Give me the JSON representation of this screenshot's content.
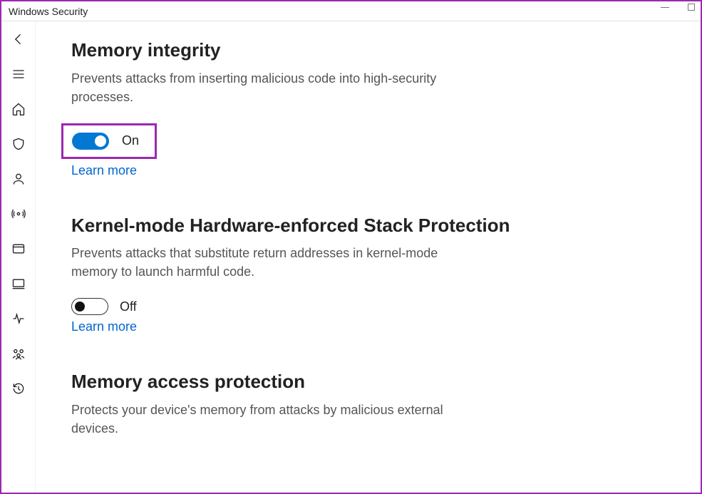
{
  "window": {
    "title": "Windows Security"
  },
  "sections": {
    "memory_integrity": {
      "heading": "Memory integrity",
      "desc": "Prevents attacks from inserting malicious code into high-security processes.",
      "toggle_state": "On",
      "learn_more": "Learn more"
    },
    "kernel_stack": {
      "heading": "Kernel-mode Hardware-enforced Stack Protection",
      "desc": "Prevents attacks that substitute return addresses in kernel-mode memory to launch harmful code.",
      "toggle_state": "Off",
      "learn_more": "Learn more"
    },
    "memory_access": {
      "heading": "Memory access protection",
      "desc": "Protects your device's memory from attacks by malicious external devices."
    }
  }
}
